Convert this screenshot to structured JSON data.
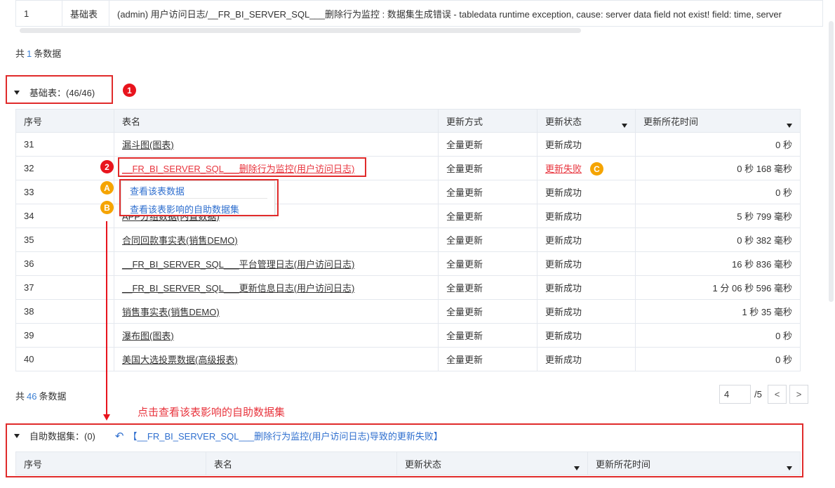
{
  "top_table": {
    "row": {
      "index": "1",
      "type": "基础表",
      "message": "(admin) 用户访问日志/__FR_BI_SERVER_SQL___删除行为监控 : 数据集生成错误 - tabledata runtime exception, cause: server data field not exist! field: time, server"
    }
  },
  "top_count": {
    "prefix": "共",
    "num": "1",
    "suffix": "条数据"
  },
  "base_section": {
    "label": "基础表：(46/46)"
  },
  "main_table": {
    "headers": [
      "序号",
      "表名",
      "更新方式",
      "更新状态",
      "更新所花时间"
    ],
    "rows": [
      {
        "idx": "31",
        "name": "漏斗图(图表)",
        "method": "全量更新",
        "status": "更新成功",
        "time": "0 秒"
      },
      {
        "idx": "32",
        "name": "__FR_BI_SERVER_SQL___删除行为监控(用户访问日志)",
        "method": "全量更新",
        "status": "更新失败",
        "time": "0 秒 168 毫秒"
      },
      {
        "idx": "33",
        "name": "",
        "method": "全量更新",
        "status": "更新成功",
        "time": "0 秒"
      },
      {
        "idx": "34",
        "name": "APP分组数据(内置数据)",
        "method": "全量更新",
        "status": "更新成功",
        "time": "5 秒 799 毫秒"
      },
      {
        "idx": "35",
        "name": "合同回款事实表(销售DEMO)",
        "method": "全量更新",
        "status": "更新成功",
        "time": "0 秒 382 毫秒"
      },
      {
        "idx": "36",
        "name": "__FR_BI_SERVER_SQL___平台管理日志(用户访问日志)",
        "method": "全量更新",
        "status": "更新成功",
        "time": "16 秒 836 毫秒"
      },
      {
        "idx": "37",
        "name": "__FR_BI_SERVER_SQL___更新信息日志(用户访问日志)",
        "method": "全量更新",
        "status": "更新成功",
        "time": "1 分 06 秒 596 毫秒"
      },
      {
        "idx": "38",
        "name": "销售事实表(销售DEMO)",
        "method": "全量更新",
        "status": "更新成功",
        "time": "1 秒 35 毫秒"
      },
      {
        "idx": "39",
        "name": "瀑布图(图表)",
        "method": "全量更新",
        "status": "更新成功",
        "time": "0 秒"
      },
      {
        "idx": "40",
        "name": "美国大选投票数据(高级报表)",
        "method": "全量更新",
        "status": "更新成功",
        "time": "0 秒"
      }
    ]
  },
  "context_menu": {
    "view_data": "查看该表数据",
    "view_affected": "查看该表影响的自助数据集"
  },
  "badges": {
    "one": "1",
    "two": "2",
    "a": "A",
    "b": "B",
    "c": "C"
  },
  "bottom_count": {
    "prefix": "共",
    "num": "46",
    "suffix": "条数据"
  },
  "pager": {
    "current": "4",
    "total": "/5",
    "prev": "<",
    "next": ">"
  },
  "annotation": "点击查看该表影响的自助数据集",
  "self_section": {
    "label": "自助数据集：(0)",
    "fail_title": "【__FR_BI_SERVER_SQL___删除行为监控(用户访问日志)导致的更新失败】"
  },
  "bottom_table": {
    "headers": [
      "序号",
      "表名",
      "更新状态",
      "更新所花时间"
    ]
  },
  "colors": {
    "accent": "#2f6fcf",
    "error": "#e8141d",
    "header_bg": "#f1f4f8",
    "badge_orange": "#f5a400"
  }
}
